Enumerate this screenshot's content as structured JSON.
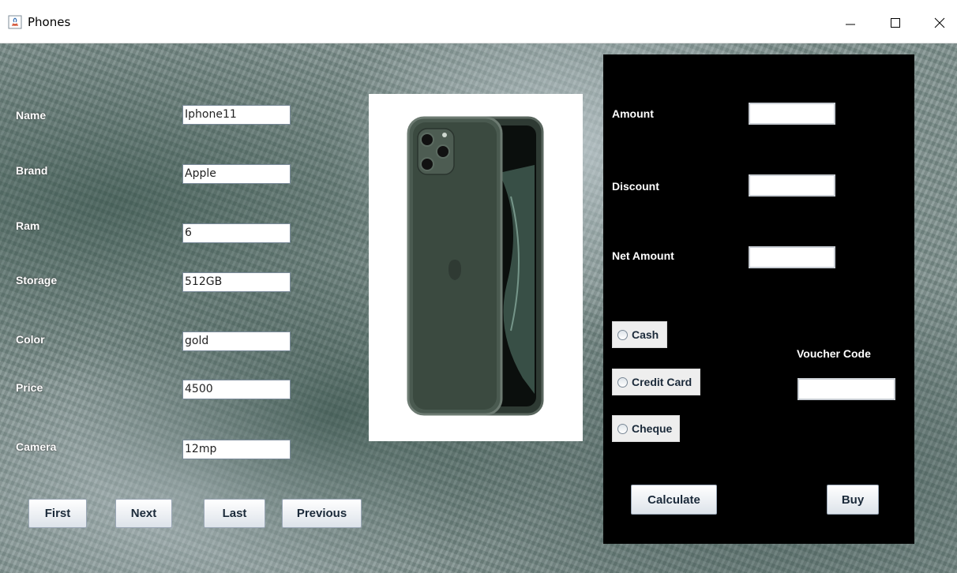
{
  "window": {
    "title": "Phones",
    "controls": {
      "minimize": "–",
      "maximize": "☐",
      "close": "X"
    }
  },
  "phone_form": {
    "fields": [
      {
        "label": "Name",
        "value": "Iphone11"
      },
      {
        "label": "Brand",
        "value": "Apple"
      },
      {
        "label": "Ram",
        "value": "6"
      },
      {
        "label": "Storage",
        "value": "512GB"
      },
      {
        "label": "Color",
        "value": "gold"
      },
      {
        "label": "Price",
        "value": "4500"
      },
      {
        "label": "Camera",
        "value": "12mp"
      }
    ]
  },
  "navigation": {
    "first": "First",
    "next": "Next",
    "last": "Last",
    "previous": "Previous"
  },
  "payment": {
    "amount_label": "Amount",
    "amount_value": "",
    "discount_label": "Discount",
    "discount_value": "",
    "net_amount_label": "Net Amount",
    "net_amount_value": "",
    "methods": [
      "Cash",
      "Credit Card",
      "Cheque"
    ],
    "voucher_label": "Voucher Code",
    "voucher_value": "",
    "calculate": "Calculate",
    "buy": "Buy"
  },
  "colors": {
    "panel_bg": "#000000",
    "phone_body": "#3b4a40"
  }
}
